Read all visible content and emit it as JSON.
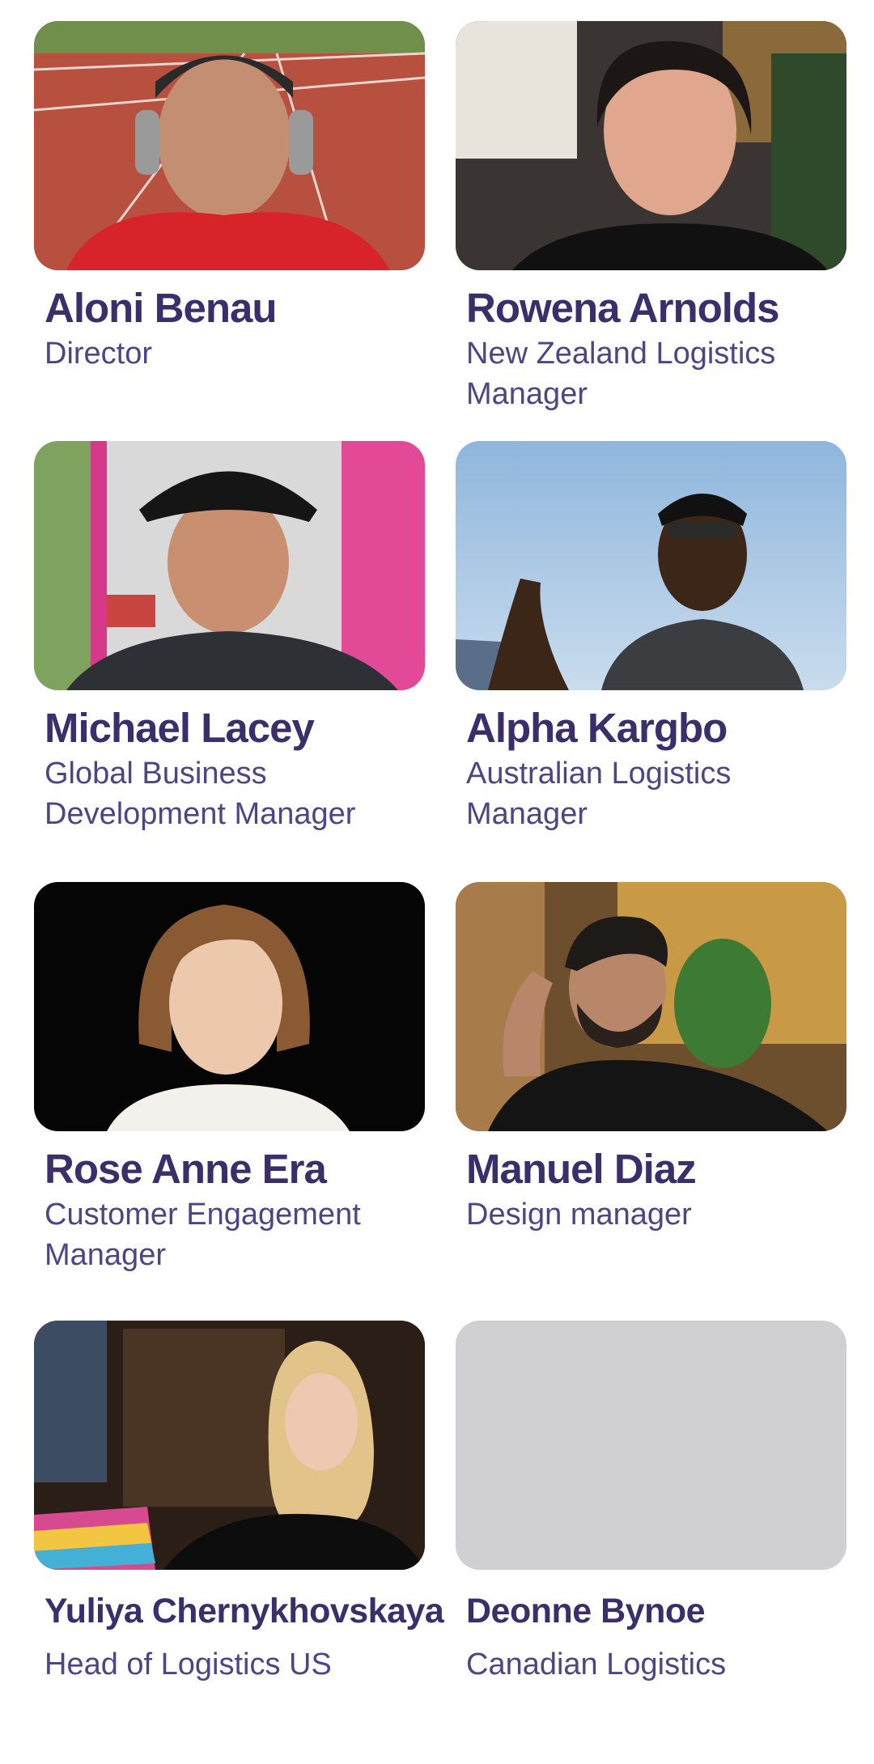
{
  "team": [
    {
      "name": "Aloni Benau",
      "role": "Director"
    },
    {
      "name": "Rowena Arnolds",
      "role": "New Zealand Logistics Manager"
    },
    {
      "name": "Michael Lacey",
      "role": "Global Business Development Manager"
    },
    {
      "name": "Alpha Kargbo",
      "role": "Australian Logistics Manager"
    },
    {
      "name": "Rose Anne Era",
      "role": "Customer Engagement Manager"
    },
    {
      "name": "Manuel Diaz",
      "role": "Design manager"
    },
    {
      "name": "Yuliya Chernykhovskaya",
      "role": "Head of Logistics US"
    },
    {
      "name": "Deonne Bynoe",
      "role": "Canadian Logistics"
    }
  ],
  "colors": {
    "name_text": "#3b2f6b",
    "role_text": "#4f4585",
    "placeholder_photo": "#d0d0d3"
  }
}
